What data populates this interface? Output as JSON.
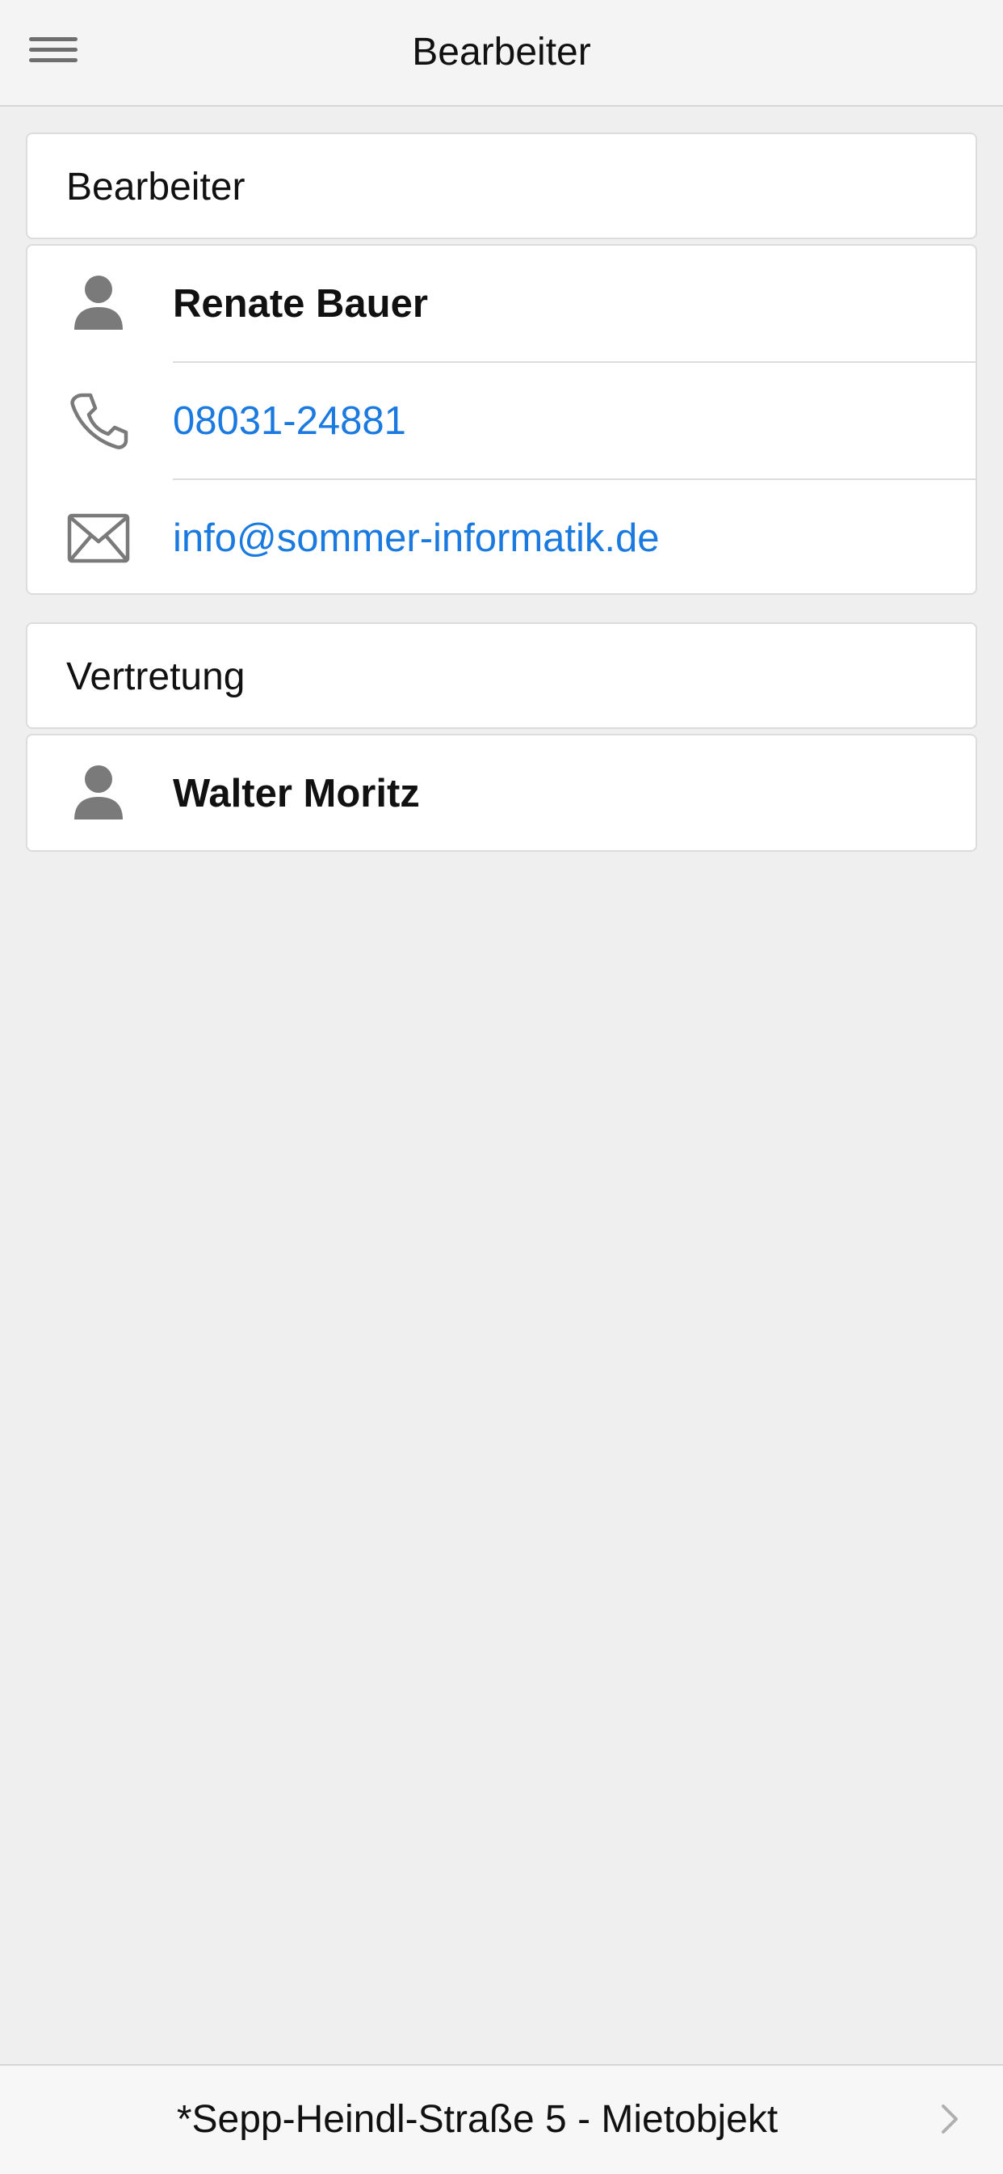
{
  "header": {
    "title": "Bearbeiter",
    "menu_icon": "hamburger-menu-icon"
  },
  "bearbeiter_section": {
    "header_label": "Bearbeiter",
    "name": "Renate Bauer",
    "phone": "08031-24881",
    "email": "info@sommer-informatik.de",
    "icons": [
      "person-icon",
      "phone-icon",
      "mail-icon"
    ]
  },
  "vertretung_section": {
    "header_label": "Vertretung",
    "name": "Walter Moritz",
    "icons": [
      "person-icon"
    ]
  },
  "footer": {
    "label": "*Sepp-Heindl-Straße 5 - Mietobjekt",
    "icon": "chevron-right-icon"
  },
  "colors": {
    "background": "#efefef",
    "link": "#1a7ae0",
    "icon": "#7a7a7a"
  }
}
